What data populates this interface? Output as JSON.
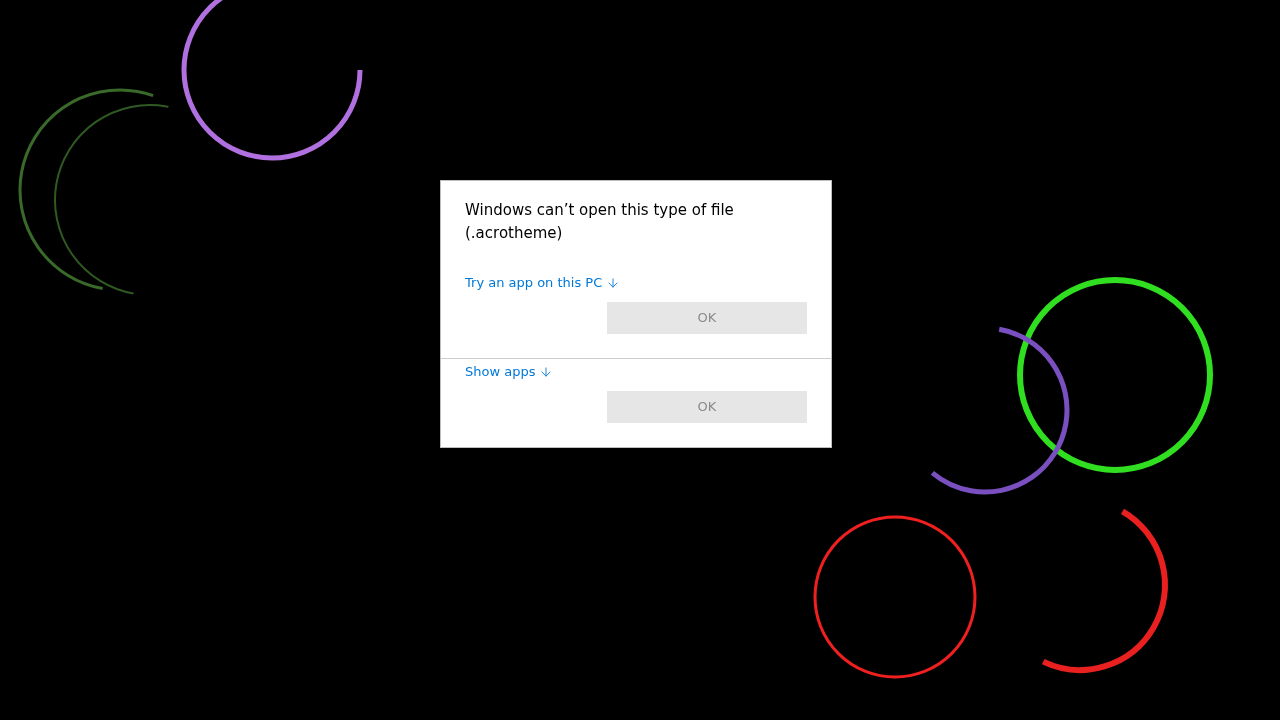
{
  "dialog": {
    "title": "Windows can’t open this type of file (.acrotheme)",
    "sections": [
      {
        "link": "Try an app on this PC",
        "button": {
          "label": "OK",
          "disabled": true
        }
      },
      {
        "link": "Show apps",
        "button": {
          "label": "OK",
          "disabled": true
        }
      }
    ]
  }
}
